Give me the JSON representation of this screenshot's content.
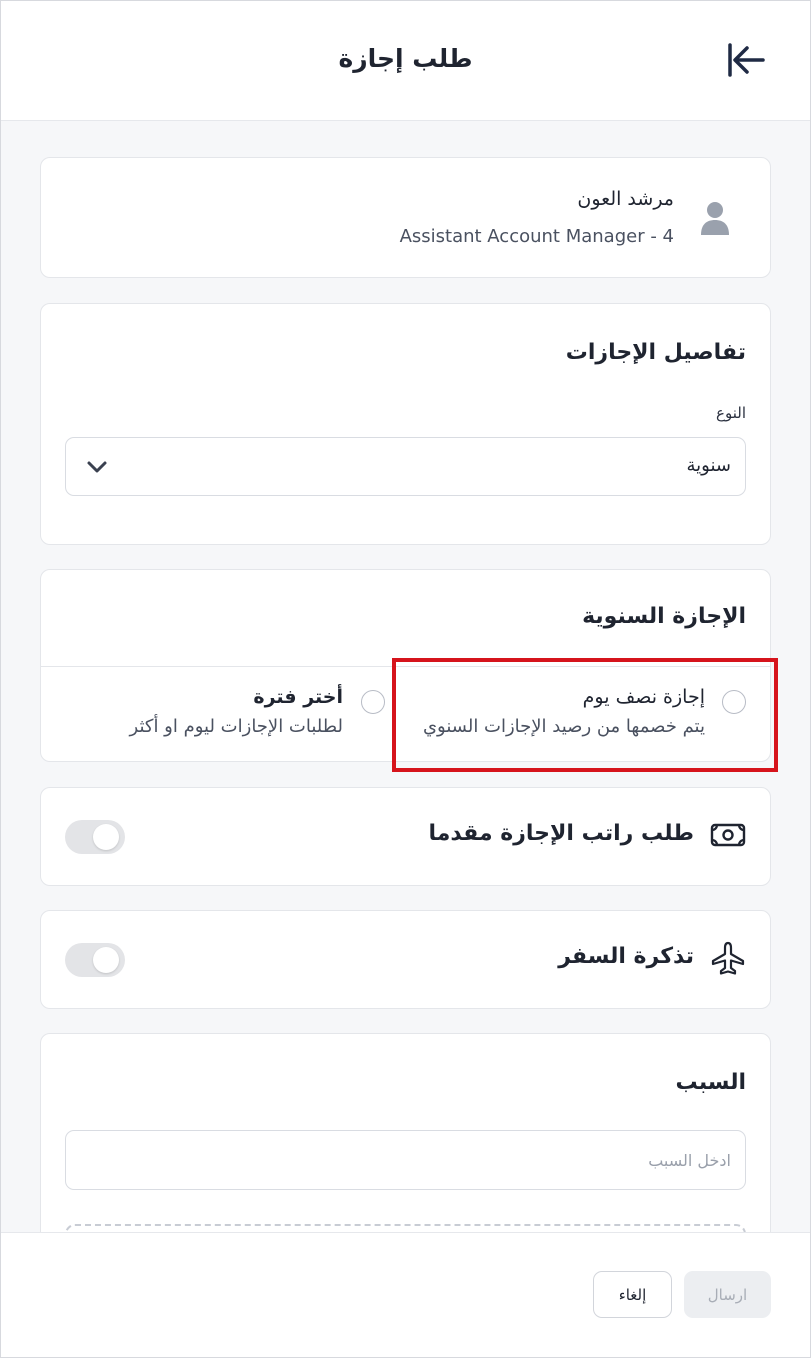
{
  "header": {
    "title": "طلب إجازة",
    "back_icon": "arrow-left-to-line-icon"
  },
  "employee": {
    "name": "مرشد العون",
    "role": "Assistant Account Manager - 4",
    "avatar_icon": "user-icon"
  },
  "details": {
    "title": "تفاصيل الإجازات",
    "type_label": "النوع",
    "type_value": "سنوية"
  },
  "annual": {
    "title": "الإجازة السنوية",
    "options": [
      {
        "title": "إجازة نصف يوم",
        "subtitle": "يتم خصمها من رصيد الإجازات السنوي",
        "selected": false
      },
      {
        "title": "أختر فترة",
        "subtitle": "لطلبات الإجازات ليوم او أكثر",
        "selected": false
      }
    ],
    "highlight_color": "#d6141c"
  },
  "salary_advance": {
    "title": "طلب راتب الإجازة مقدما",
    "icon": "money-icon",
    "enabled": false
  },
  "travel_ticket": {
    "title": "تذكرة السفر",
    "icon": "airplane-icon",
    "enabled": false
  },
  "reason": {
    "title": "السبب",
    "placeholder": "ادخل السبب",
    "value": ""
  },
  "footer": {
    "cancel_label": "إلغاء",
    "submit_label": "ارسال"
  },
  "colors": {
    "text": "#1f2430",
    "muted": "#4a5160",
    "border": "#e4e6ea",
    "disabled_bg": "#eceef1"
  }
}
